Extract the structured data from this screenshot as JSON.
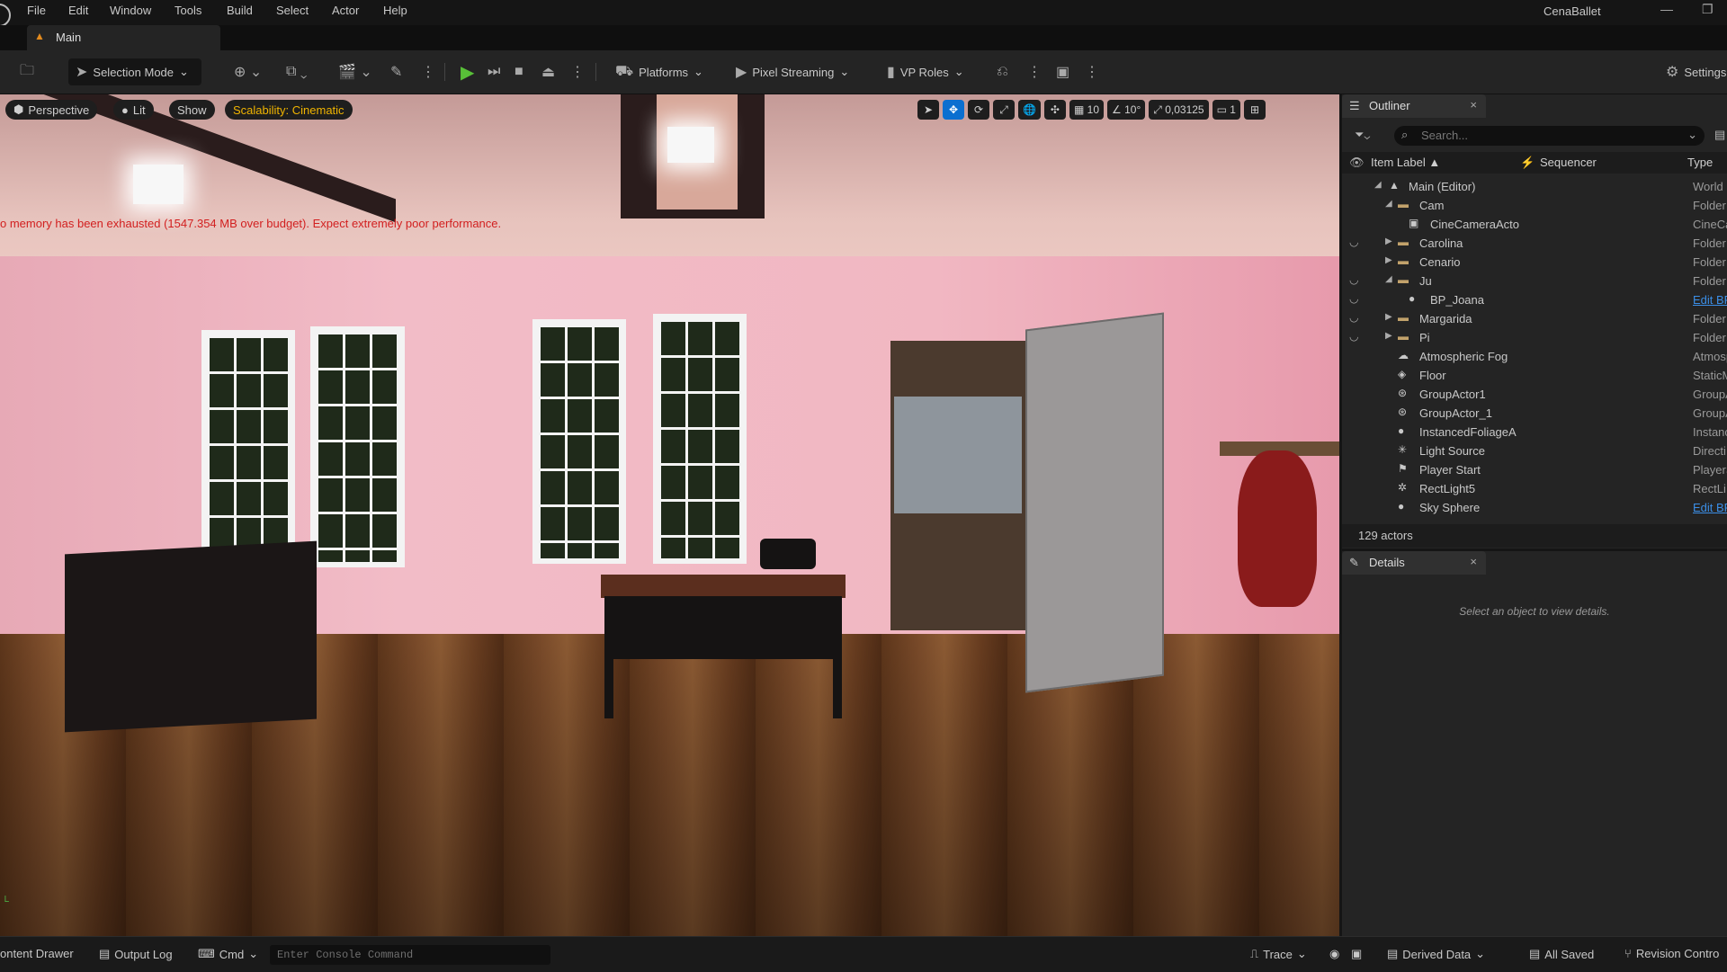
{
  "menubar": {
    "items": [
      "File",
      "Edit",
      "Window",
      "Tools",
      "Build",
      "Select",
      "Actor",
      "Help"
    ],
    "project_name": "CenaBallet"
  },
  "tabs": {
    "level_tab": "Main"
  },
  "toolbar": {
    "selection_mode": "Selection Mode",
    "platforms": "Platforms",
    "pixel_streaming": "Pixel Streaming",
    "vp_roles": "VP Roles",
    "settings": "Settings"
  },
  "viewport": {
    "perspective": "Perspective",
    "lit": "Lit",
    "show": "Show",
    "scalability": "Scalability: Cinematic",
    "warning": "o memory has been exhausted (1547.354 MB over budget). Expect extremely poor performance.",
    "grid_snap": "10",
    "rotation_snap": "10°",
    "scale_snap": "0,03125",
    "camera_speed": "1"
  },
  "outliner": {
    "title": "Outliner",
    "search_placeholder": "Search...",
    "col_label": "Item Label",
    "col_sequencer": "Sequencer",
    "col_type": "Type",
    "rows": [
      {
        "name": "Main (Editor)",
        "type": "World"
      },
      {
        "name": "Cam",
        "type": "Folder"
      },
      {
        "name": "CineCameraActo",
        "type": "CineCa"
      },
      {
        "name": "Carolina",
        "type": "Folder"
      },
      {
        "name": "Cenario",
        "type": "Folder"
      },
      {
        "name": "Ju",
        "type": "Folder"
      },
      {
        "name": "BP_Joana",
        "type": "Edit BP"
      },
      {
        "name": "Margarida",
        "type": "Folder"
      },
      {
        "name": "Pi",
        "type": "Folder"
      },
      {
        "name": "Atmospheric Fog",
        "type": "Atmosp"
      },
      {
        "name": "Floor",
        "type": "StaticM"
      },
      {
        "name": "GroupActor1",
        "type": "GroupA"
      },
      {
        "name": "GroupActor_1",
        "type": "GroupA"
      },
      {
        "name": "InstancedFoliageA",
        "type": "Instanc"
      },
      {
        "name": "Light Source",
        "type": "Directi"
      },
      {
        "name": "Player Start",
        "type": "PlayerS"
      },
      {
        "name": "RectLight5",
        "type": "RectLi"
      },
      {
        "name": "Sky Sphere",
        "type": "Edit BP"
      }
    ],
    "actor_count": "129 actors"
  },
  "details": {
    "title": "Details",
    "empty_text": "Select an object to view details."
  },
  "bottombar": {
    "content_drawer": "ontent Drawer",
    "output_log": "Output Log",
    "cmd": "Cmd",
    "console_placeholder": "Enter Console Command",
    "trace": "Trace",
    "derived_data": "Derived Data",
    "all_saved": "All Saved",
    "revision_control": "Revision Contro"
  }
}
